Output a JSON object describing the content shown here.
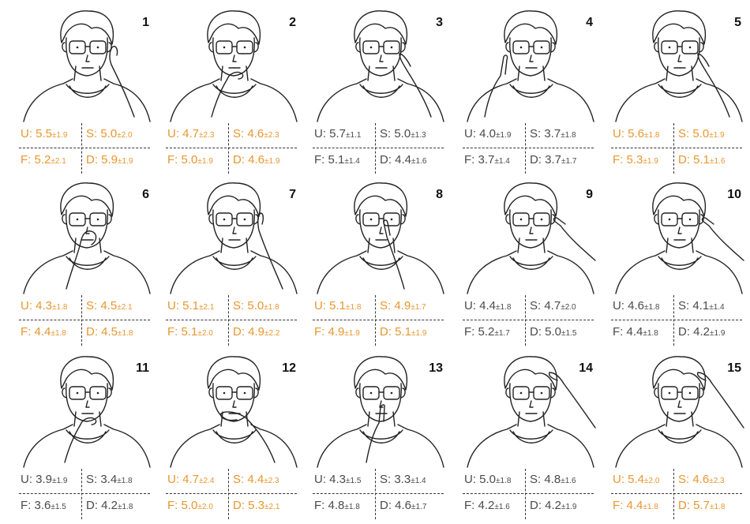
{
  "colors": {
    "highlight": "#e8962f",
    "normal": "#4a4a4a"
  },
  "figures": [
    {
      "number": "1",
      "highlight": true,
      "gesture": "hand-behind-ear",
      "ratings": [
        [
          "U: ",
          "5.5",
          "±1.9"
        ],
        [
          "S: ",
          "5.0",
          "±2.0"
        ],
        [
          "F: ",
          "5.2",
          "±2.1"
        ],
        [
          "D: ",
          "5.9",
          "±1.9"
        ]
      ]
    },
    {
      "number": "2",
      "highlight": true,
      "gesture": "hand-on-chin",
      "ratings": [
        [
          "U: ",
          "4.7",
          "±2.3"
        ],
        [
          "S: ",
          "4.6",
          "±2.3"
        ],
        [
          "F: ",
          "5.0",
          "±1.9"
        ],
        [
          "D: ",
          "4.6",
          "±1.9"
        ]
      ]
    },
    {
      "number": "3",
      "highlight": false,
      "gesture": "hand-on-cheek",
      "ratings": [
        [
          "U: ",
          "5.7",
          "±1.1"
        ],
        [
          "S: ",
          "5.0",
          "±1.3"
        ],
        [
          "F: ",
          "5.1",
          "±1.4"
        ],
        [
          "D: ",
          "4.4",
          "±1.6"
        ]
      ]
    },
    {
      "number": "4",
      "highlight": false,
      "gesture": "profile-finger-on-lips",
      "ratings": [
        [
          "U: ",
          "4.0",
          "±1.9"
        ],
        [
          "S: ",
          "3.7",
          "±1.8"
        ],
        [
          "F: ",
          "3.7",
          "±1.4"
        ],
        [
          "D: ",
          "3.7",
          "±1.7"
        ]
      ]
    },
    {
      "number": "5",
      "highlight": true,
      "gesture": "hand-on-cheek",
      "ratings": [
        [
          "U: ",
          "5.6",
          "±1.8"
        ],
        [
          "S: ",
          "5.0",
          "±1.9"
        ],
        [
          "F: ",
          "5.3",
          "±1.9"
        ],
        [
          "D: ",
          "5.1",
          "±1.6"
        ]
      ]
    },
    {
      "number": "6",
      "highlight": true,
      "gesture": "hand-over-nose",
      "ratings": [
        [
          "U: ",
          "4.3",
          "±1.8"
        ],
        [
          "S: ",
          "4.5",
          "±2.1"
        ],
        [
          "F: ",
          "4.4",
          "±1.8"
        ],
        [
          "D: ",
          "4.5",
          "±1.8"
        ]
      ]
    },
    {
      "number": "7",
      "highlight": true,
      "gesture": "hand-at-temple",
      "ratings": [
        [
          "U: ",
          "5.1",
          "±2.1"
        ],
        [
          "S: ",
          "5.0",
          "±1.8"
        ],
        [
          "F: ",
          "5.1",
          "±2.0"
        ],
        [
          "D: ",
          "4.9",
          "±2.2"
        ]
      ]
    },
    {
      "number": "8",
      "highlight": true,
      "gesture": "finger-on-glasses",
      "ratings": [
        [
          "U: ",
          "5.1",
          "±1.8"
        ],
        [
          "S: ",
          "4.9",
          "±1.7"
        ],
        [
          "F: ",
          "4.9",
          "±1.9"
        ],
        [
          "D: ",
          "5.1",
          "±1.9"
        ]
      ]
    },
    {
      "number": "9",
      "highlight": false,
      "gesture": "finger-at-ear",
      "ratings": [
        [
          "U: ",
          "4.4",
          "±1.8"
        ],
        [
          "S: ",
          "4.7",
          "±2.0"
        ],
        [
          "F: ",
          "5.2",
          "±1.7"
        ],
        [
          "D: ",
          "5.0",
          "±1.5"
        ]
      ]
    },
    {
      "number": "10",
      "highlight": false,
      "gesture": "finger-at-temple",
      "ratings": [
        [
          "U: ",
          "4.6",
          "±1.8"
        ],
        [
          "S: ",
          "4.1",
          "±1.4"
        ],
        [
          "F: ",
          "4.4",
          "±1.8"
        ],
        [
          "D: ",
          "4.2",
          "±1.9"
        ]
      ]
    },
    {
      "number": "11",
      "highlight": false,
      "gesture": "hand-on-chin",
      "ratings": [
        [
          "U: ",
          "3.9",
          "±1.9"
        ],
        [
          "S: ",
          "3.4",
          "±1.8"
        ],
        [
          "F: ",
          "3.6",
          "±1.5"
        ],
        [
          "D: ",
          "4.2",
          "±1.8"
        ]
      ]
    },
    {
      "number": "12",
      "highlight": true,
      "gesture": "hand-over-mouth",
      "ratings": [
        [
          "U: ",
          "4.7",
          "±2.4"
        ],
        [
          "S: ",
          "4.4",
          "±2.3"
        ],
        [
          "F: ",
          "5.0",
          "±2.0"
        ],
        [
          "D: ",
          "5.3",
          "±2.1"
        ]
      ]
    },
    {
      "number": "13",
      "highlight": false,
      "gesture": "finger-on-lips",
      "ratings": [
        [
          "U: ",
          "4.3",
          "±1.5"
        ],
        [
          "S: ",
          "3.3",
          "±1.4"
        ],
        [
          "F: ",
          "4.8",
          "±1.8"
        ],
        [
          "D: ",
          "4.6",
          "±1.7"
        ]
      ]
    },
    {
      "number": "14",
      "highlight": false,
      "gesture": "hand-on-head",
      "ratings": [
        [
          "U: ",
          "5.0",
          "±1.8"
        ],
        [
          "S: ",
          "4.8",
          "±1.6"
        ],
        [
          "F: ",
          "4.2",
          "±1.6"
        ],
        [
          "D: ",
          "4.2",
          "±1.9"
        ]
      ]
    },
    {
      "number": "15",
      "highlight": true,
      "gesture": "hand-on-head",
      "ratings": [
        [
          "U: ",
          "5.4",
          "±2.0"
        ],
        [
          "S: ",
          "4.6",
          "±2.3"
        ],
        [
          "F: ",
          "4.4",
          "±1.8"
        ],
        [
          "D: ",
          "5.7",
          "±1.8"
        ]
      ]
    }
  ]
}
